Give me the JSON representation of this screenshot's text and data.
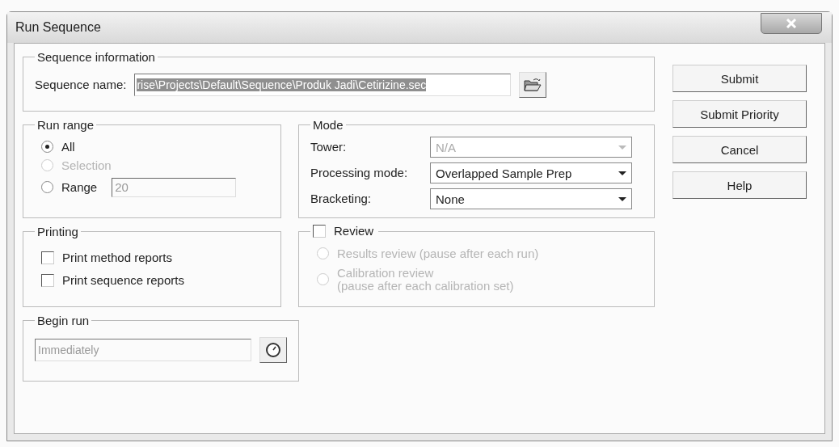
{
  "window": {
    "title": "Run Sequence"
  },
  "sequence_information": {
    "title": "Sequence information",
    "label": "Sequence name:",
    "value": "rise\\Projects\\Default\\Sequence\\Produk Jadi\\Cetirizine.sec",
    "selected": true
  },
  "run_range": {
    "title": "Run range",
    "options": [
      {
        "label": "All",
        "selected": true,
        "disabled": false
      },
      {
        "label": "Selection",
        "selected": false,
        "disabled": true
      },
      {
        "label": "Range",
        "selected": false,
        "disabled": false
      }
    ],
    "range_value": "20"
  },
  "mode": {
    "title": "Mode",
    "fields": [
      {
        "label": "Tower:",
        "value": "N/A",
        "disabled": true
      },
      {
        "label": "Processing mode:",
        "value": "Overlapped Sample Prep",
        "disabled": false
      },
      {
        "label": "Bracketing:",
        "value": "None",
        "disabled": false
      }
    ]
  },
  "printing": {
    "title": "Printing",
    "options": [
      {
        "label": "Print method reports",
        "checked": false
      },
      {
        "label": "Print sequence reports",
        "checked": false
      }
    ]
  },
  "review": {
    "title": "Review",
    "checked": false,
    "options": [
      {
        "label": "Results review (pause after each run)",
        "selected": false,
        "disabled": true
      },
      {
        "label": "Calibration review\n(pause after each calibration set)",
        "selected": false,
        "disabled": true
      }
    ]
  },
  "begin_run": {
    "title": "Begin run",
    "value": "Immediately"
  },
  "buttons": [
    "Submit",
    "Submit Priority",
    "Cancel",
    "Help"
  ]
}
